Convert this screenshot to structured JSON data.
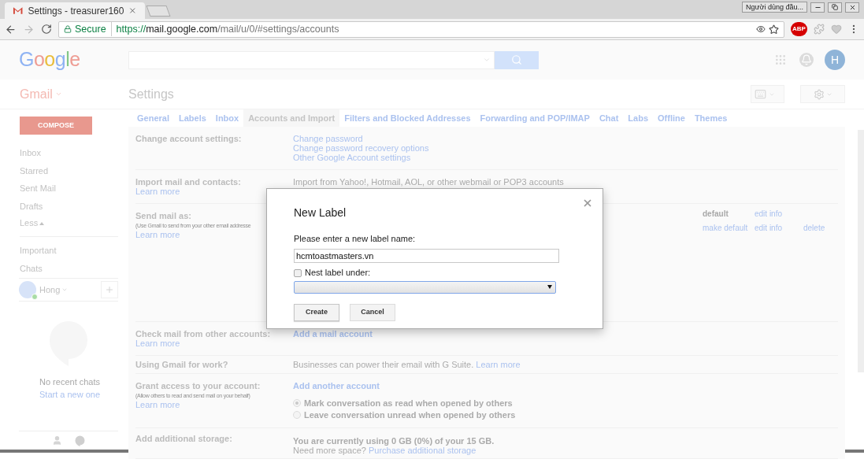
{
  "browser": {
    "tab_title": "Settings - treasurer160",
    "profile": "Người dùng đầu...",
    "address": {
      "secure": "Secure",
      "scheme": "https://",
      "host": "mail.google.com",
      "path": "/mail/u/0/#settings/accounts"
    },
    "abp": "ABP"
  },
  "header": {
    "logo": "Google",
    "avatar": "H"
  },
  "toolbar": {
    "app": "Gmail",
    "title": "Settings"
  },
  "sidebar": {
    "compose": "COMPOSE",
    "nav": [
      {
        "label": "Inbox",
        "kind": "item"
      },
      {
        "label": "Starred",
        "kind": "item"
      },
      {
        "label": "Sent Mail",
        "kind": "item"
      },
      {
        "label": "Drafts",
        "kind": "item"
      },
      {
        "label": "Less",
        "kind": "toggle"
      }
    ],
    "labels": [
      {
        "label": "Important"
      },
      {
        "label": "Chats"
      }
    ],
    "chat_user": {
      "name": "Hong",
      "online": true
    },
    "empty": "No recent chats",
    "start": "Start a new one"
  },
  "tabs": [
    {
      "label": "General",
      "selected": false
    },
    {
      "label": "Labels",
      "selected": false
    },
    {
      "label": "Inbox",
      "selected": false
    },
    {
      "label": "Accounts and Import",
      "selected": true
    },
    {
      "label": "Filters and Blocked Addresses",
      "selected": false
    },
    {
      "label": "Forwarding and POP/IMAP",
      "selected": false
    },
    {
      "label": "Chat",
      "selected": false
    },
    {
      "label": "Labs",
      "selected": false
    },
    {
      "label": "Offline",
      "selected": false
    },
    {
      "label": "Themes",
      "selected": false
    }
  ],
  "rows": [
    {
      "label": "Change account settings:",
      "items": [
        {
          "kind": "link",
          "text": "Change password"
        },
        {
          "kind": "link",
          "text": "Change password recovery options"
        },
        {
          "kind": "link",
          "text": "Other Google Account settings"
        }
      ]
    },
    {
      "label": "Import mail and contacts:",
      "learn_more": "Learn more",
      "items": [
        {
          "kind": "text",
          "text": "Import from Yahoo!, Hotmail, AOL, or other webmail or POP3 accounts"
        }
      ]
    },
    {
      "label": "Send mail as:",
      "note": "(Use Gmail to send from your other email addresse",
      "learn_more": "Learn more",
      "items": [
        {
          "kind": "account",
          "status": "default",
          "status_link": false,
          "edit": "edit info"
        },
        {
          "kind": "account",
          "status": "make default",
          "status_link": true,
          "edit": "edit info",
          "delete": "delete"
        }
      ]
    },
    {
      "label": "Check mail from other accounts:",
      "learn_more": "Learn more",
      "items": [
        {
          "kind": "bold_link",
          "text": "Add a mail account"
        }
      ]
    },
    {
      "label": "Using Gmail for work?",
      "items": [
        {
          "kind": "text_link",
          "text": "Businesses can power their email with G Suite.",
          "link": "Learn more"
        }
      ]
    },
    {
      "label": "Grant access to your account:",
      "note": "(Allow others to read and send mail on your behalf)",
      "learn_more": "Learn more",
      "items": [
        {
          "kind": "bold_link",
          "text": "Add another account"
        },
        {
          "kind": "radio",
          "label": "Mark conversation as read when opened by others",
          "selected": true
        },
        {
          "kind": "radio",
          "label": "Leave conversation unread when opened by others",
          "selected": false
        }
      ]
    },
    {
      "label": "Add additional storage:",
      "items": [
        {
          "kind": "bold",
          "text": "You are currently using 0 GB (0%) of your 15 GB."
        },
        {
          "kind": "text_link",
          "text": "Need more space?",
          "link": "Purchase additional storage"
        }
      ]
    }
  ],
  "dialog": {
    "title": "New Label",
    "prompt": "Please enter a new label name:",
    "value": "hcmtoastmasters.vn",
    "nest": {
      "label": "Nest label under:",
      "checked": false
    },
    "buttons": [
      "Create",
      "Cancel"
    ]
  }
}
